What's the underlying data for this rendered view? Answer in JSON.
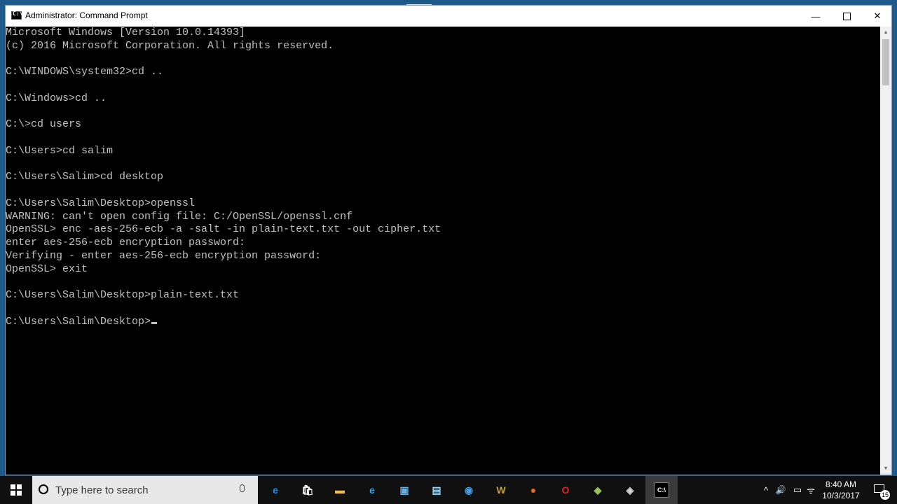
{
  "window": {
    "title": "Administrator: Command Prompt",
    "icon_label": "C:\\_",
    "buttons": {
      "minimize": "—",
      "close": "✕"
    }
  },
  "console": {
    "lines": [
      "Microsoft Windows [Version 10.0.14393]",
      "(c) 2016 Microsoft Corporation. All rights reserved.",
      "",
      "C:\\WINDOWS\\system32>cd ..",
      "",
      "C:\\Windows>cd ..",
      "",
      "C:\\>cd users",
      "",
      "C:\\Users>cd salim",
      "",
      "C:\\Users\\Salim>cd desktop",
      "",
      "C:\\Users\\Salim\\Desktop>openssl",
      "WARNING: can't open config file: C:/OpenSSL/openssl.cnf",
      "OpenSSL> enc -aes-256-ecb -a -salt -in plain-text.txt -out cipher.txt",
      "enter aes-256-ecb encryption password:",
      "Verifying - enter aes-256-ecb encryption password:",
      "OpenSSL> exit",
      "",
      "C:\\Users\\Salim\\Desktop>plain-text.txt",
      "",
      "C:\\Users\\Salim\\Desktop>"
    ],
    "text_color": "#c0c0c0",
    "background": "#000000"
  },
  "taskbar": {
    "search_placeholder": "Type here to search",
    "apps": [
      {
        "name": "edge",
        "glyph": "e",
        "color": "#1e90e6"
      },
      {
        "name": "store",
        "glyph": "🛍",
        "color": "#ffffff"
      },
      {
        "name": "file-explorer",
        "glyph": "▬",
        "color": "#f0c040"
      },
      {
        "name": "internet-explorer",
        "glyph": "e",
        "color": "#35a6e8"
      },
      {
        "name": "network",
        "glyph": "▣",
        "color": "#6ab0e0"
      },
      {
        "name": "notepad",
        "glyph": "▤",
        "color": "#9fd0e8"
      },
      {
        "name": "chrome",
        "glyph": "◉",
        "color": "#4aa0e0"
      },
      {
        "name": "word",
        "glyph": "W",
        "color": "#c8a040"
      },
      {
        "name": "firefox",
        "glyph": "●",
        "color": "#e66a1e"
      },
      {
        "name": "opera",
        "glyph": "O",
        "color": "#e0202a"
      },
      {
        "name": "app-green",
        "glyph": "◆",
        "color": "#9ac060"
      },
      {
        "name": "app-paint",
        "glyph": "◈",
        "color": "#d8d8d8"
      },
      {
        "name": "command-prompt",
        "glyph": "C:\\",
        "color": "#ffffff"
      }
    ],
    "tray": {
      "chevron": "^",
      "volume": "🔊",
      "battery": "▭",
      "wifi": "ᯤ"
    },
    "time": "8:40 AM",
    "date": "10/3/2017",
    "notification_count": "15"
  }
}
